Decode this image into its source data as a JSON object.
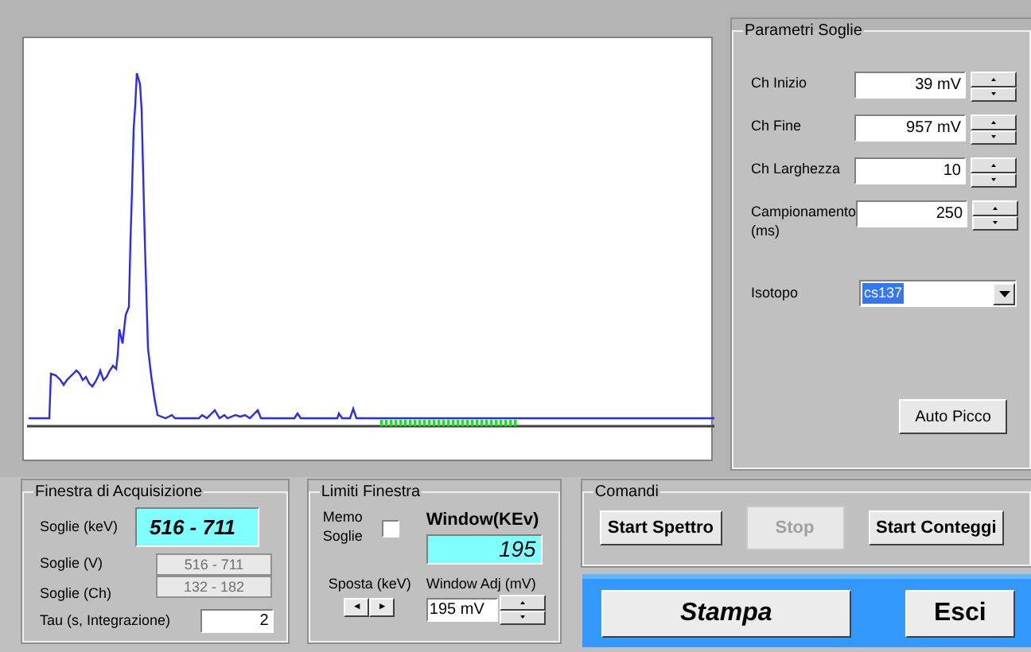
{
  "parametri_soglie": {
    "title": "Parametri Soglie",
    "fields": [
      {
        "label": "Ch Inizio",
        "value": "39 mV"
      },
      {
        "label": "Ch Fine",
        "value": "957 mV"
      },
      {
        "label": "Ch Larghezza",
        "value": "10"
      },
      {
        "label": "Campionamento (ms)",
        "value": "250"
      }
    ],
    "isotopo": {
      "label": "Isotopo",
      "value": "cs137",
      "selected": true
    },
    "auto_button": "Auto Picco"
  },
  "finestra_acquisizione": {
    "title": "Finestra di Acquisizione",
    "keV": {
      "label": "Soglie (keV)",
      "value": "516 - 711"
    },
    "fields": [
      {
        "label": "Soglie (V)",
        "value": "516 - 711",
        "disabled": true
      },
      {
        "label": "Soglie (Ch)",
        "value": "132 - 182",
        "disabled": true
      }
    ],
    "tau": {
      "label": "Tau (s, Integrazione)",
      "value": "2"
    }
  },
  "limiti_finestra": {
    "title": "Limiti Finestra",
    "memo": {
      "label": "Memo Soglie",
      "checked": false
    },
    "window": {
      "label": "Window(KEv)",
      "value": "195"
    },
    "sposta": {
      "label": "Sposta (keV)",
      "left": "◄",
      "right": "►"
    },
    "adj": {
      "label": "Window Adj (mV)",
      "value": "195 mV"
    }
  },
  "comandi": {
    "title": "Comandi",
    "buttons": [
      {
        "label": "Start Spettro",
        "disabled": false
      },
      {
        "label": "Stop",
        "disabled": true
      },
      {
        "label": "Start Conteggi",
        "disabled": false
      }
    ]
  },
  "actions": [
    {
      "label": "Stampa",
      "kind": "italic"
    },
    {
      "label": "Esci",
      "kind": "plain"
    }
  ]
}
